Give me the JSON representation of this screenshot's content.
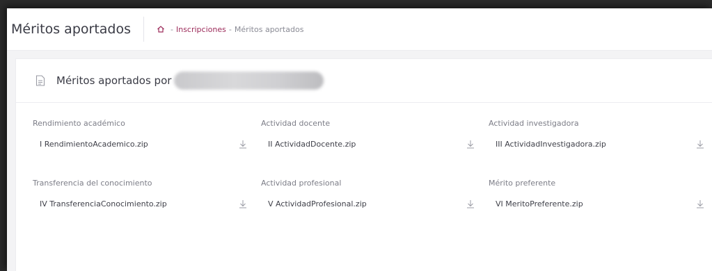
{
  "header": {
    "title": "Méritos aportados",
    "breadcrumb": {
      "home_icon": "home-icon",
      "link": "Inscripciones",
      "current": "Méritos aportados",
      "separator": "-"
    }
  },
  "card": {
    "title": "Méritos aportados por",
    "icon": "document-icon"
  },
  "merits": [
    {
      "label": "Rendimiento académico",
      "file": "I RendimientoAcademico.zip"
    },
    {
      "label": "Actividad docente",
      "file": "II ActividadDocente.zip"
    },
    {
      "label": "Actividad investigadora",
      "file": "III ActividadInvestigadora.zip"
    },
    {
      "label": "Transferencia del conocimiento",
      "file": "IV TransferenciaConocimiento.zip"
    },
    {
      "label": "Actividad profesional",
      "file": "V ActividadProfesional.zip"
    },
    {
      "label": "Mérito preferente",
      "file": "VI MeritoPreferente.zip"
    }
  ],
  "colors": {
    "accent": "#9c2b5a",
    "text": "#3a3b45"
  }
}
